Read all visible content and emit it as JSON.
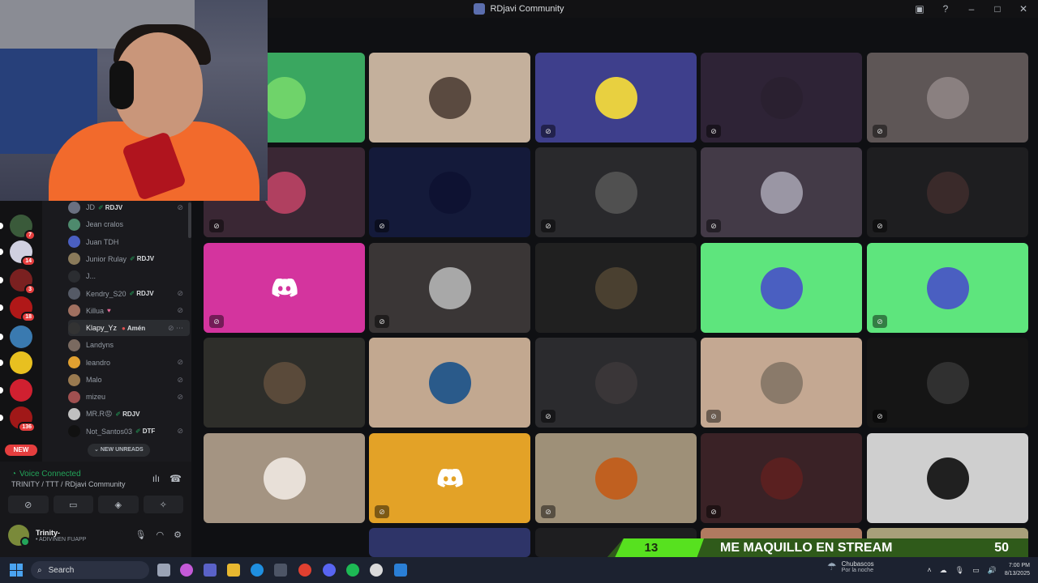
{
  "window": {
    "title": "RDjavi Community"
  },
  "members": [
    {
      "name": "JD",
      "tag": "RDJV",
      "tag_icon": "✐",
      "muted": true,
      "color": "#6a7080"
    },
    {
      "name": "Jean cralos",
      "tag": "",
      "muted": false,
      "color": "#4e8a6d"
    },
    {
      "name": "Juan TDH",
      "tag": "",
      "muted": false,
      "color": "#4a5fc1"
    },
    {
      "name": "Junior Rulay",
      "tag": "RDJV",
      "tag_icon": "✐",
      "muted": false,
      "color": "#8a7a5a"
    },
    {
      "name": "J...",
      "tag": "",
      "muted": false,
      "color": "#2b2d31"
    },
    {
      "name": "Kendry_S20",
      "tag": "RDJV",
      "tag_icon": "✐",
      "muted": true,
      "color": "#555a66"
    },
    {
      "name": "Killua",
      "tag": "",
      "tag_icon": "♥",
      "muted": true,
      "color": "#a07060"
    },
    {
      "name": "Klapy_Yz",
      "tag": "Amén",
      "tag_icon": "●",
      "muted": true,
      "color": "#333",
      "hover": true
    },
    {
      "name": "Landyns",
      "tag": "",
      "muted": false,
      "color": "#7a6a60"
    },
    {
      "name": "leandro",
      "tag": "",
      "muted": true,
      "color": "#e0a030"
    },
    {
      "name": "Malo",
      "tag": "",
      "muted": true,
      "color": "#9a7a50"
    },
    {
      "name": "mizeu",
      "tag": "",
      "muted": true,
      "color": "#a05050"
    },
    {
      "name": "MR.R😡",
      "tag": "RDJV",
      "tag_icon": "✐",
      "muted": false,
      "color": "#c0c0c0"
    },
    {
      "name": "Not_Santos03",
      "tag": "DTF",
      "tag_icon": "✐",
      "muted": true,
      "color": "#111"
    }
  ],
  "servers": [
    {
      "color": "#3a5a3a",
      "badge": "7"
    },
    {
      "color": "#d0d0e0",
      "badge": "14"
    },
    {
      "color": "#7a2020",
      "badge": "3"
    },
    {
      "color": "#b01818",
      "badge": "18"
    },
    {
      "color": "#3a7ab0",
      "badge": ""
    },
    {
      "color": "#e8c020",
      "badge": ""
    },
    {
      "color": "#d02030",
      "badge": ""
    },
    {
      "color": "#a01818",
      "badge": "136"
    }
  ],
  "rail": {
    "new_label": "NEW"
  },
  "list": {
    "new_unreads": "NEW UNREADS"
  },
  "voice": {
    "status": "Voice Connected",
    "path": "TRINITY / TTT / RDjavi Community"
  },
  "user": {
    "name": "Trinity-",
    "status": "• ADIVINEN FUAPP"
  },
  "tiles": [
    {
      "bg": "#3aa760",
      "av": "#6fd36a",
      "muted": false
    },
    {
      "bg": "#c4b09c",
      "av": "#5a4a40",
      "muted": false
    },
    {
      "bg": "#3e3f8c",
      "av": "#e8d040",
      "muted": true
    },
    {
      "bg": "#2e2336",
      "av": "#2a2030",
      "muted": true
    },
    {
      "bg": "#5e5656",
      "av": "#8a8080",
      "muted": true
    },
    {
      "bg": "#3a2734",
      "av": "#b04060",
      "muted": true
    },
    {
      "bg": "#141a3a",
      "av": "#0e1232",
      "muted": true
    },
    {
      "bg": "#29292c",
      "av": "#505050",
      "muted": true
    },
    {
      "bg": "#433a47",
      "av": "#9a96a4",
      "muted": true
    },
    {
      "bg": "#1e1e20",
      "av": "#3a2a2a",
      "muted": true
    },
    {
      "bg": "#d4349e",
      "av": "discord",
      "muted": true
    },
    {
      "bg": "#3a3636",
      "av": "#a8a8a8",
      "muted": true
    },
    {
      "bg": "#202020",
      "av": "#4a4030",
      "muted": false
    },
    {
      "bg": "#5ee57d",
      "av": "#4a5fc1",
      "muted": false
    },
    {
      "bg": "#5ee57d",
      "av": "#4a5fc1",
      "muted": true
    },
    {
      "bg": "#2e2e2a",
      "av": "#5a4a3a",
      "muted": false
    },
    {
      "bg": "#c2a890",
      "av": "#2a5a8a",
      "muted": false
    },
    {
      "bg": "#2b2b2e",
      "av": "#3a3638",
      "muted": true
    },
    {
      "bg": "#c4a892",
      "av": "#8a7a6a",
      "muted": true
    },
    {
      "bg": "#151515",
      "av": "#303030",
      "muted": true
    },
    {
      "bg": "#a49482",
      "av": "#e8e0d8",
      "muted": false
    },
    {
      "bg": "#e3a227",
      "av": "discord",
      "muted": true
    },
    {
      "bg": "#9e9078",
      "av": "#c06020",
      "muted": true
    },
    {
      "bg": "#3a2226",
      "av": "#5a2020",
      "muted": true
    },
    {
      "bg": "#cfcfcf",
      "av": "#202020",
      "muted": false
    }
  ],
  "banner": {
    "left_number": "13",
    "text": "ME MAQUILLO EN STREAM",
    "right_number": "50"
  },
  "taskbar": {
    "search": "Search",
    "weather_title": "Chubascos",
    "weather_sub": "Por la noche",
    "time": "7:00 PM",
    "date": "8/13/2025"
  }
}
